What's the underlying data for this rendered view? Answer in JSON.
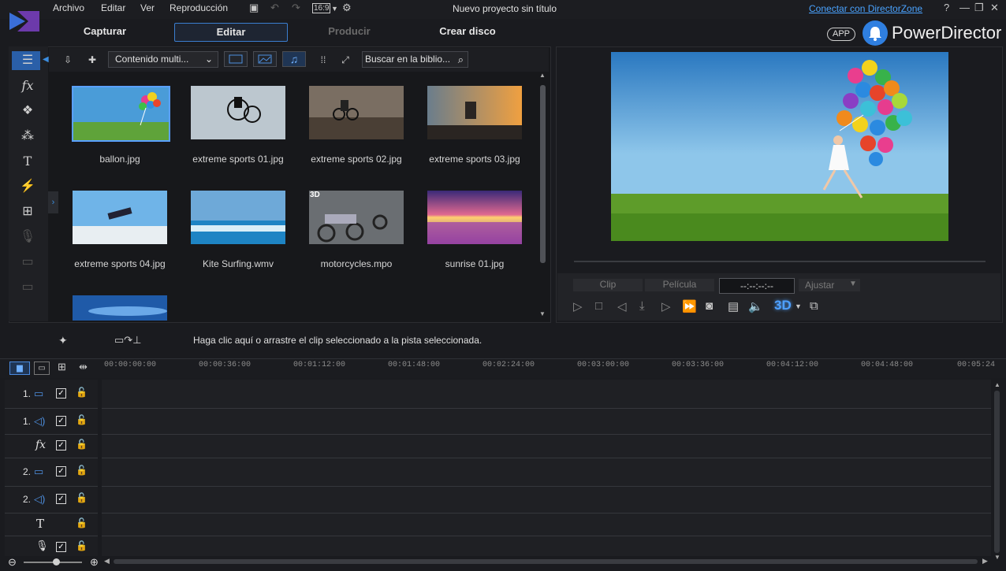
{
  "menu": [
    "Archivo",
    "Editar",
    "Ver",
    "Reproducción"
  ],
  "aspect_label": "16:9",
  "window_title": "Nuevo proyecto sin título",
  "directorzone_link": "Conectar con DirectorZone",
  "modes": [
    "Capturar",
    "Editar",
    "Producir",
    "Crear disco"
  ],
  "brand": {
    "app_badge": "APP",
    "name": "PowerDirector"
  },
  "library": {
    "content_dropdown": "Contenido multi...",
    "search_placeholder": "Buscar en la biblio...",
    "items": [
      {
        "name": "ballon.jpg"
      },
      {
        "name": "extreme sports 01.jpg"
      },
      {
        "name": "extreme sports 02.jpg"
      },
      {
        "name": "extreme sports 03.jpg"
      },
      {
        "name": "extreme sports 04.jpg"
      },
      {
        "name": "Kite Surfing.wmv"
      },
      {
        "name": "motorcycles.mpo",
        "badge": "3D"
      },
      {
        "name": "sunrise 01.jpg"
      }
    ]
  },
  "preview": {
    "clip_label": "Clip",
    "pelicula_label": "Película",
    "timecode": "--:--:--:--",
    "ajustar_label": "Ajustar",
    "three_d_label": "3D"
  },
  "hint": "Haga clic aquí o arrastre el clip seleccionado a la pista seleccionada.",
  "timeline": {
    "ticks": [
      "00:00:00:00",
      "00:00:36:00",
      "00:01:12:00",
      "00:01:48:00",
      "00:02:24:00",
      "00:03:00:00",
      "00:03:36:00",
      "00:04:12:00",
      "00:04:48:00",
      "00:05:24"
    ],
    "tracks": [
      {
        "num": "1.",
        "type": "video"
      },
      {
        "num": "1.",
        "type": "audio"
      },
      {
        "num": "",
        "type": "fx"
      },
      {
        "num": "2.",
        "type": "video"
      },
      {
        "num": "2.",
        "type": "audio"
      },
      {
        "num": "",
        "type": "title"
      },
      {
        "num": "",
        "type": "voice"
      }
    ]
  }
}
